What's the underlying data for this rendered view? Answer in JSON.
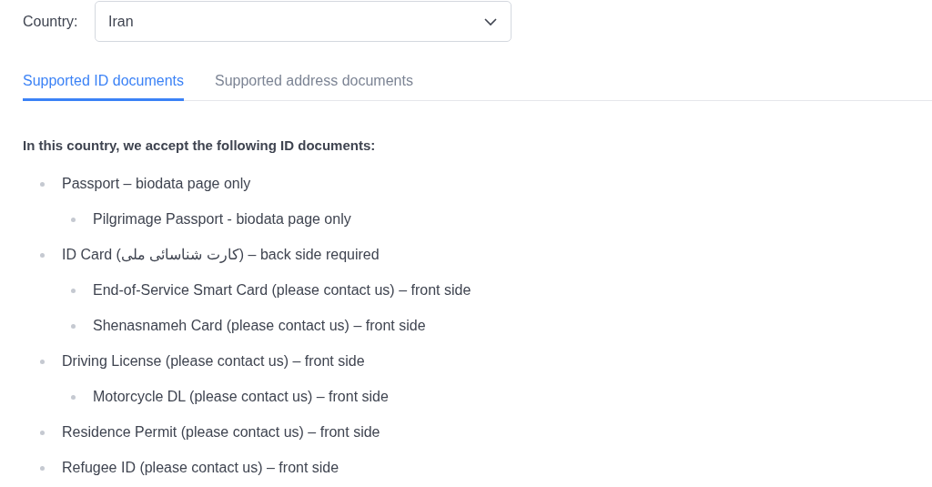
{
  "country_field": {
    "label": "Country:",
    "value": "Iran"
  },
  "tabs": [
    {
      "label": "Supported ID documents",
      "selected": true
    },
    {
      "label": "Supported address documents",
      "selected": false
    }
  ],
  "heading": "In this country, we accept the following ID documents:",
  "documents": [
    {
      "text": "Passport – biodata page only",
      "children": [
        {
          "text": "Pilgrimage Passport - biodata page only"
        }
      ]
    },
    {
      "text": "ID Card (کارت شناسائی ملی) – back side required",
      "children": [
        {
          "text": "End-of-Service Smart Card (please contact us) – front side"
        },
        {
          "text": "Shenasnameh Card (please contact us) – front side"
        }
      ]
    },
    {
      "text": "Driving License (please contact us) – front side",
      "children": [
        {
          "text": "Motorcycle DL (please contact us) – front side"
        }
      ]
    },
    {
      "text": "Residence Permit (please contact us) – front side"
    },
    {
      "text": "Refugee ID (please contact us) – front side"
    }
  ]
}
